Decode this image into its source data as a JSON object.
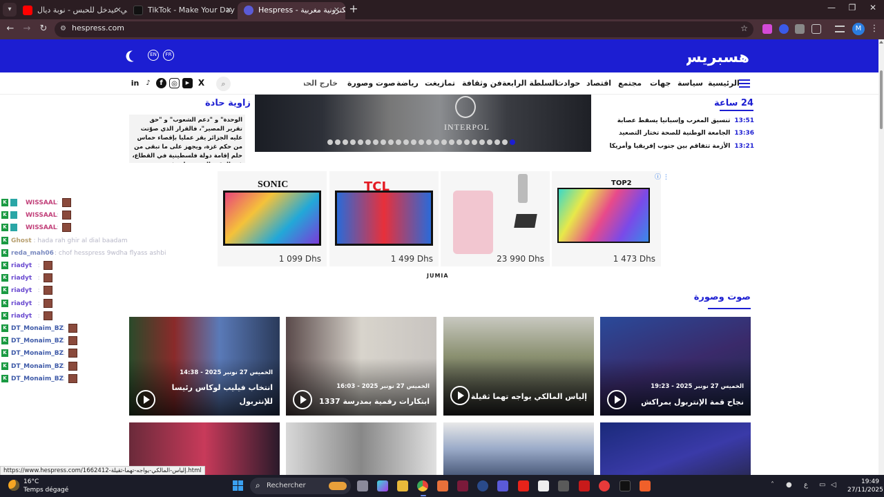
{
  "browser": {
    "tabs": [
      {
        "title": "كلشي عيدخل للحبس - نوبة ديال",
        "favicon_color": "#ff0000"
      },
      {
        "title": "TikTok - Make Your Day",
        "favicon_color": "#111111"
      },
      {
        "title": "Hespress - جريدة إلكترونية مغربية",
        "favicon_color": "#5b5bd6",
        "active": true
      }
    ],
    "new_tab": "+",
    "url": "hespress.com",
    "status_url": "https://www.hespress.com/1662412-إلياس-المالكي-يواجه-تهما-ثقيلة.html",
    "profile_initial": "M"
  },
  "site": {
    "logo_text": "هسبريس",
    "lang": {
      "en": "EN",
      "fr": "FR"
    },
    "nav": [
      "الرئيسية",
      "سياسة",
      "جهات",
      "مجتمع",
      "اقتصاد",
      "حوادث",
      "السلطة الرابعة",
      "فن وثقافة",
      "تمازيغت",
      "رياضة",
      "صوت وصورة",
      "خارج الحدو"
    ],
    "social_icons": [
      "linkedin-icon",
      "tiktok-icon",
      "facebook-icon",
      "instagram-icon",
      "youtube-icon",
      "x-icon"
    ],
    "social_glyphs": [
      "in",
      "♪",
      "f",
      "◎",
      "▶",
      "X"
    ],
    "search_glyph": "⌕"
  },
  "latest": {
    "title": "24 ساعة",
    "items": [
      {
        "time": "13:51",
        "text": "تنسيق المغرب وإسبانيا يسقط عصابة"
      },
      {
        "time": "13:36",
        "text": "الجامعة الوطنية للصحة تختار التصعيد"
      },
      {
        "time": "13:21",
        "text": "الأزمة تتفاقم بين جنوب إفريقيا وأمريكا"
      }
    ]
  },
  "opinion": {
    "title": "زاوية حادة",
    "excerpt": "الوحدة\" و \"دعم الشعوب\" و \"حق تقرير المصير\"، فالقرار الذي صوّتت عليه الجزائر يقر عمليا بإقصاء حماس من حكم غزة، ويجهز على ما تبقى من حلم إقامة دولة فلسطينية في القطاع، في الوقت الذي تحولت فيه..."
  },
  "hero": {
    "caption_text": "INTERPOL",
    "slide_count": 25,
    "active_slide": 24
  },
  "ad": {
    "choices_glyph": "ⓘ ⋮",
    "network": "JUMIA",
    "cards": [
      {
        "brand": "SONIC",
        "price": "1 099 Dhs"
      },
      {
        "brand": "TCL",
        "price": "1 499 Dhs"
      },
      {
        "brand": "",
        "price": "23 990 Dhs"
      },
      {
        "brand": "TOP2",
        "price": "1 473 Dhs"
      }
    ]
  },
  "videos": {
    "section_title": "صوت وصورة",
    "items": [
      {
        "date": "الخميس 27 نونبر 2025 - 19:23",
        "title_lines": [
          "نجاح قمة الإنتربول بمراكش"
        ]
      },
      {
        "date": "",
        "title_lines": [
          "إلياس المالكي يواجه تهما ثقيلة"
        ]
      },
      {
        "date": "الخميس 27 نونبر 2025 - 16:03",
        "title_lines": [
          "ابتكارات رقمية بمدرسة 1337"
        ]
      },
      {
        "date": "الخميس 27 نونبر 2025 - 14:38",
        "title_lines": [
          "انتخاب فيليب لوكاس رئيسا",
          "للإنتربول"
        ]
      }
    ]
  },
  "chat": [
    {
      "user": "WISSAAL",
      "msg": "",
      "color": "#c2417a",
      "badge2": true,
      "emote": true
    },
    {
      "user": "WISSAAL",
      "msg": "",
      "color": "#c2417a",
      "badge2": true,
      "emote": true
    },
    {
      "user": "WISSAAL",
      "msg": "",
      "color": "#c2417a",
      "badge2": true,
      "emote": true
    },
    {
      "user": "Ghost",
      "msg": ": hada rah ghir al dial baadam",
      "color": "#b8a070",
      "badge2": false,
      "emote": false
    },
    {
      "user": "reda_mah06",
      "msg": ": chof hesspress 9wdha flyass ashbi",
      "color": "#7a8ac0",
      "badge2": false,
      "emote": false
    },
    {
      "user": "riadyt",
      "msg": "",
      "color": "#6a4ad0",
      "badge2": false,
      "emote": true
    },
    {
      "user": "riadyt",
      "msg": "",
      "color": "#6a4ad0",
      "badge2": false,
      "emote": true
    },
    {
      "user": "riadyt",
      "msg": "",
      "color": "#6a4ad0",
      "badge2": false,
      "emote": true
    },
    {
      "user": "riadyt",
      "msg": "",
      "color": "#6a4ad0",
      "badge2": false,
      "emote": true
    },
    {
      "user": "riadyt",
      "msg": "",
      "color": "#6a4ad0",
      "badge2": false,
      "emote": true
    },
    {
      "user": "DT_Monaim_BZ",
      "msg": "",
      "color": "#3e5aa8",
      "badge2": false,
      "emote": true
    },
    {
      "user": "DT_Monaim_BZ",
      "msg": "",
      "color": "#3e5aa8",
      "badge2": false,
      "emote": true
    },
    {
      "user": "DT_Monaim_BZ",
      "msg": "",
      "color": "#3e5aa8",
      "badge2": false,
      "emote": true
    },
    {
      "user": "DT_Monaim_BZ",
      "msg": "",
      "color": "#3e5aa8",
      "badge2": false,
      "emote": true
    },
    {
      "user": "DT_Monaim_BZ",
      "msg": "",
      "color": "#3e5aa8",
      "badge2": false,
      "emote": true
    }
  ],
  "taskbar": {
    "weather_temp": "16°C",
    "weather_desc": "Temps dégagé",
    "search_label": "Rechercher",
    "time": "19:49",
    "date": "27/11/2025",
    "lang_indicator": "ع"
  },
  "colors": {
    "brand": "#1c1ed2",
    "tab_bar": "#2b1d22",
    "toolbar": "#4a3038"
  }
}
